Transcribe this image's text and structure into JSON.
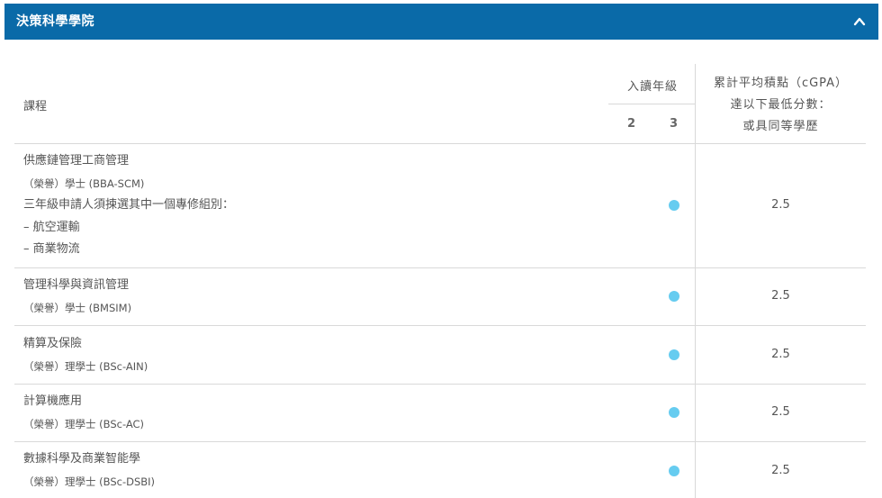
{
  "header": {
    "title": "決策科學學院",
    "collapse_icon": "chevron-up-icon"
  },
  "table": {
    "col_course": "課程",
    "col_year": "入讀年級",
    "col_year_2": "2",
    "col_year_3": "3",
    "col_gpa_line1": "累計平均積點（cGPA）",
    "col_gpa_line2": "達以下最低分數：",
    "col_gpa_line3": "或具同等學歷",
    "rows": [
      {
        "lines": [
          "供應鏈管理工商管理",
          "（榮譽）學士 (BBA-SCM)",
          "三年級申請人須揀選其中一個專修組別：",
          "– 航空運輸",
          "– 商業物流"
        ],
        "year3": true,
        "gpa": "2.5"
      },
      {
        "lines": [
          "管理科學與資訊管理",
          "（榮譽）學士 (BMSIM)"
        ],
        "year3": true,
        "gpa": "2.5"
      },
      {
        "lines": [
          "精算及保險",
          "（榮譽）理學士 (BSc-AIN)"
        ],
        "year3": true,
        "gpa": "2.5"
      },
      {
        "lines": [
          "計算機應用",
          "（榮譽）理學士 (BSc-AC)"
        ],
        "year3": true,
        "gpa": "2.5"
      },
      {
        "lines": [
          "數據科學及商業智能學",
          "（榮譽）理學士 (BSc-DSBI)"
        ],
        "year3": true,
        "gpa": "2.5"
      }
    ]
  },
  "colors": {
    "header_bg": "#0a6aa8",
    "dot": "#66ccf0",
    "border": "#d9d9d9"
  }
}
